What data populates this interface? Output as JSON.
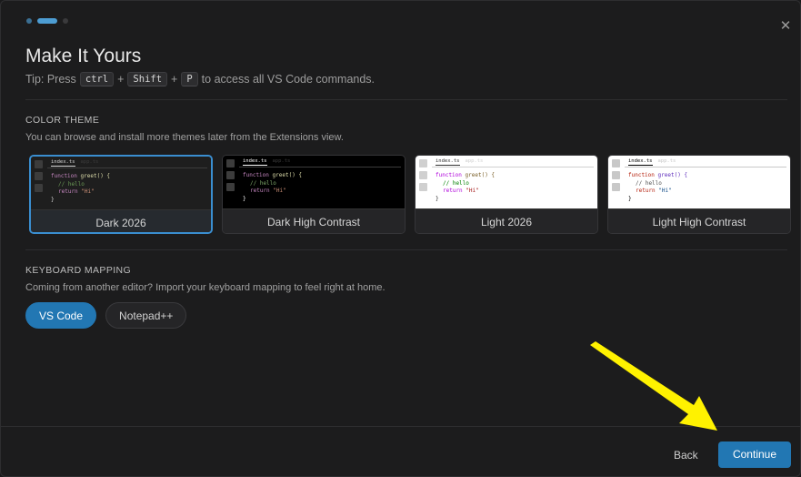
{
  "header": {
    "close_icon": "close-icon",
    "title": "Make It Yours",
    "tip_prefix": "Tip: Press",
    "keys": [
      "ctrl",
      "Shift",
      "P"
    ],
    "plus": "+",
    "tip_suffix": "to access all VS Code commands."
  },
  "progress": {
    "total_steps": 3,
    "current_step": 2
  },
  "color_theme": {
    "heading": "COLOR THEME",
    "description": "You can browse and install more themes later from the Extensions view.",
    "selected": "Dark 2026",
    "preview": {
      "tab_active": "index.ts",
      "tab_inactive": "app.ts",
      "line1_kw": "function",
      "line1_fn": "greet() {",
      "line2": "// hello",
      "line3_kw": "return",
      "line3_str": "\"Hi\"",
      "line4": "}"
    },
    "themes": [
      {
        "label": "Dark 2026",
        "bg": "#1e1e1e",
        "fg": "#d4d4d4",
        "kw": "#c586c0",
        "fn": "#dcdcaa",
        "cm": "#6a9955",
        "str": "#ce9178",
        "box": "#3c3c3c",
        "tab": "#2a2a2a"
      },
      {
        "label": "Dark High Contrast",
        "bg": "#000000",
        "fg": "#ffffff",
        "kw": "#c586c0",
        "fn": "#dcdcaa",
        "cm": "#7ca668",
        "str": "#ce9178",
        "box": "#3c3c3c",
        "tab": "#000000"
      },
      {
        "label": "Light 2026",
        "bg": "#ffffff",
        "fg": "#333333",
        "kw": "#af00db",
        "fn": "#795e26",
        "cm": "#008000",
        "str": "#a31515",
        "box": "#d0d0d0",
        "tab": "#f3f3f3"
      },
      {
        "label": "Light High Contrast",
        "bg": "#ffffff",
        "fg": "#000000",
        "kw": "#b5200d",
        "fn": "#5e2cbc",
        "cm": "#515151",
        "str": "#0f4a85",
        "box": "#c8c8c8",
        "tab": "#ffffff"
      }
    ]
  },
  "keyboard_mapping": {
    "heading": "KEYBOARD MAPPING",
    "description": "Coming from another editor? Import your keyboard mapping to feel right at home.",
    "options": [
      "VS Code",
      "Notepad++"
    ],
    "selected": "VS Code"
  },
  "footer": {
    "back_label": "Back",
    "continue_label": "Continue"
  },
  "colors": {
    "accent": "#2277b3",
    "annotation_arrow": "#fff200"
  }
}
